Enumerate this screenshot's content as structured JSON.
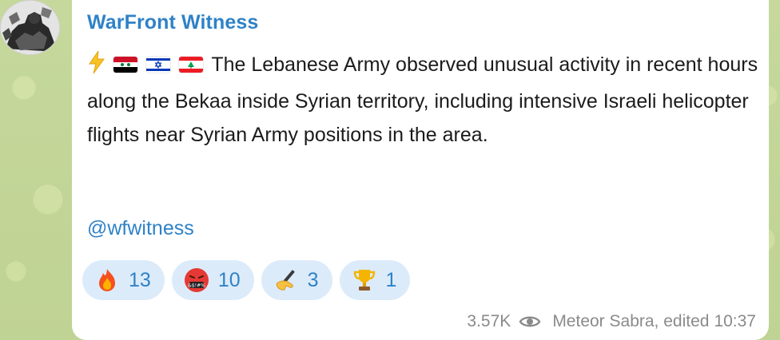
{
  "channel": {
    "name": "WarFront Witness",
    "avatar_icon": "soldier-avatar-icon"
  },
  "message": {
    "prefix_icons": [
      "lightning-icon",
      "syria-flag-icon",
      "israel-flag-icon",
      "lebanon-flag-icon"
    ],
    "text": "The Lebanese Army observed unusual activity in recent hours along the Bekaa inside Syrian territory, including intensive Israeli helicopter flights near Syrian Army positions in the area.",
    "signature": "@wfwitness"
  },
  "reactions": [
    {
      "icon": "fire-icon",
      "count": "13"
    },
    {
      "icon": "cursing-face-icon",
      "count": "10"
    },
    {
      "icon": "writing-hand-icon",
      "count": "3"
    },
    {
      "icon": "trophy-icon",
      "count": "1"
    }
  ],
  "meta": {
    "views": "3.57K",
    "views_icon": "eye-icon",
    "author": "Meteor Sabra, edited",
    "time": "10:37"
  },
  "colors": {
    "link": "#2f82c7",
    "reaction_bg": "#dcebfa",
    "meta_text": "#8a8a8a"
  }
}
